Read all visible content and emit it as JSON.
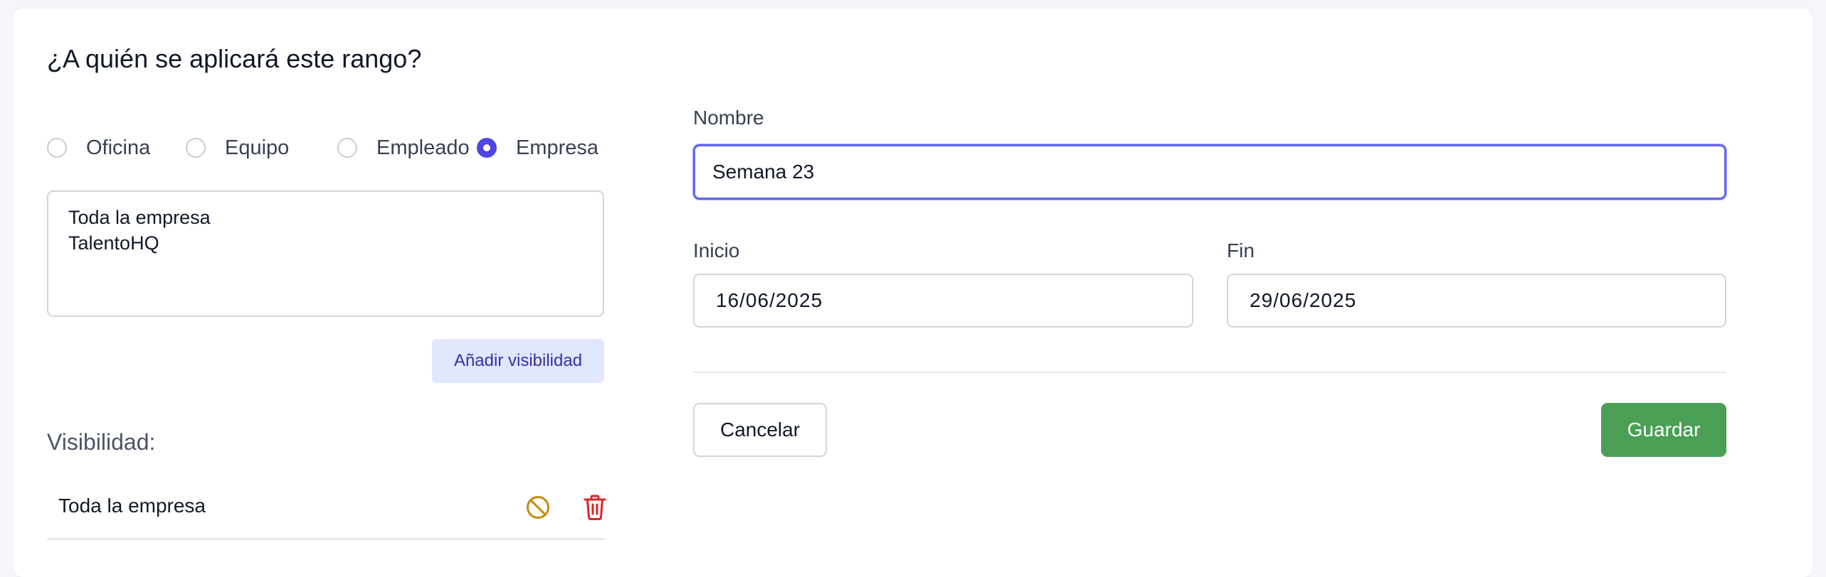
{
  "section": {
    "title": "¿A quién se aplicará este rango?"
  },
  "scope": {
    "options": [
      {
        "label": "Oficina",
        "checked": false
      },
      {
        "label": "Equipo",
        "checked": false
      },
      {
        "label": "Empleado",
        "checked": false
      },
      {
        "label": "Empresa",
        "checked": true
      }
    ],
    "selection_lines": [
      "Toda la empresa",
      "TalentoHQ"
    ],
    "add_button": "Añadir visibilidad"
  },
  "visibility": {
    "title": "Visibilidad:",
    "items": [
      {
        "label": "Toda la empresa",
        "icons": [
          "ban-icon",
          "trash-icon"
        ]
      }
    ]
  },
  "form": {
    "name_label": "Nombre",
    "name_value": "Semana 23",
    "start_label": "Inicio",
    "start_value": "16/06/2025",
    "end_label": "Fin",
    "end_value": "29/06/2025",
    "cancel_label": "Cancelar",
    "save_label": "Guardar"
  },
  "colors": {
    "accent": "#4f46e5",
    "save": "#4a9f54",
    "ban_icon": "#c68a12",
    "trash_icon": "#dc2626",
    "add_button_bg": "#e0e7ff"
  }
}
